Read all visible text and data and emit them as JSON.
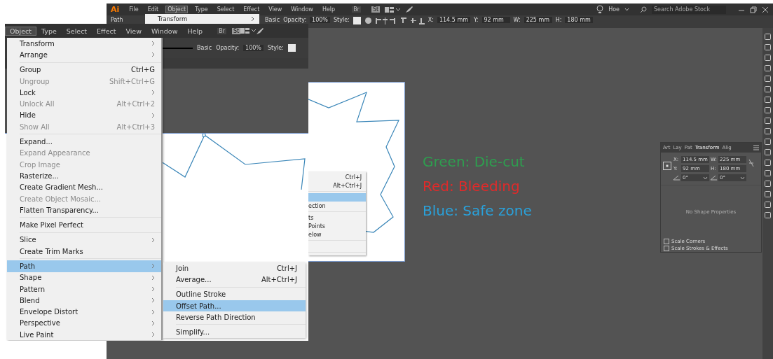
{
  "back_window": {
    "app_logo": "Ai",
    "menu": [
      {
        "label": "File",
        "selected": false
      },
      {
        "label": "Edit",
        "selected": false
      },
      {
        "label": "Object",
        "selected": true
      },
      {
        "label": "Type",
        "selected": false
      },
      {
        "label": "Select",
        "selected": false
      },
      {
        "label": "Effect",
        "selected": false
      },
      {
        "label": "View",
        "selected": false
      },
      {
        "label": "Window",
        "selected": false
      },
      {
        "label": "Help",
        "selected": false
      }
    ],
    "bridge_button": "Br",
    "stock_button": "St",
    "workspace": "Hoe",
    "search": {
      "placeholder": "Search Adobe Stock"
    },
    "open_menu": {
      "label": "Transform"
    },
    "control_bar": {
      "selection": "Path",
      "brush": "Basic",
      "opacity_label": "Opacity:",
      "opacity": "100%",
      "style_label": "Style:",
      "fields": [
        {
          "label": "X:",
          "value": "114.5 mm"
        },
        {
          "label": "Y:",
          "value": "92 mm"
        },
        {
          "label": "W:",
          "value": "225 mm"
        },
        {
          "label": "H:",
          "value": "180 mm"
        }
      ]
    },
    "submenu_fragment": [
      {
        "kind": "shortcut",
        "text": "Ctrl+J"
      },
      {
        "kind": "shortcut",
        "text": "Alt+Ctrl+J"
      },
      {
        "kind": "separator"
      },
      {
        "kind": "highlight"
      },
      {
        "kind": "text",
        "text": "ection"
      },
      {
        "kind": "separator"
      },
      {
        "kind": "text",
        "text": "ts"
      },
      {
        "kind": "text",
        "text": "Points"
      },
      {
        "kind": "text",
        "text": "elow"
      },
      {
        "kind": "separator"
      },
      {
        "kind": "blank"
      },
      {
        "kind": "separator"
      }
    ],
    "annotations": [
      {
        "text": "Green: Die-cut",
        "color": "#2e9e4f"
      },
      {
        "text": "Red: Bleeding",
        "color": "#e02a2a"
      },
      {
        "text": "Blue: Safe zone",
        "color": "#2aa1da"
      }
    ],
    "transform_panel": {
      "tabs": [
        {
          "label": "Art",
          "selected": false
        },
        {
          "label": "Lay",
          "selected": false
        },
        {
          "label": "Pat",
          "selected": false
        },
        {
          "label": "Transform",
          "selected": true
        },
        {
          "label": "Alig",
          "selected": false
        }
      ],
      "fields": [
        {
          "label": "X:",
          "value": "114.5 mm"
        },
        {
          "label": "W:",
          "value": "225 mm"
        },
        {
          "label": "Y:",
          "value": "92 mm"
        },
        {
          "label": "H:",
          "value": "180 mm"
        }
      ],
      "angles": [
        {
          "value": "0°"
        },
        {
          "value": "0°"
        }
      ],
      "message": "No Shape Properties",
      "options": [
        {
          "label": "Scale Corners",
          "checked": false
        },
        {
          "label": "Scale Strokes & Effects",
          "checked": false
        }
      ]
    }
  },
  "front_window": {
    "menu": [
      {
        "label": "Object",
        "selected": true
      },
      {
        "label": "Type",
        "selected": false
      },
      {
        "label": "Select",
        "selected": false
      },
      {
        "label": "Effect",
        "selected": false
      },
      {
        "label": "View",
        "selected": false
      },
      {
        "label": "Window",
        "selected": false
      },
      {
        "label": "Help",
        "selected": false
      }
    ],
    "bridge_button": "Br",
    "stock_button": "St",
    "control_bar": {
      "brush": "Basic",
      "opacity_label": "Opacity:",
      "opacity": "100%",
      "style_label": "Style:"
    },
    "object_menu": [
      {
        "kind": "item",
        "label": "Transform",
        "submenu": true,
        "disabled": false,
        "selected": false
      },
      {
        "kind": "item",
        "label": "Arrange",
        "submenu": true,
        "disabled": false,
        "selected": false
      },
      {
        "kind": "separator"
      },
      {
        "kind": "item",
        "label": "Group",
        "shortcut": "Ctrl+G",
        "submenu": false,
        "disabled": false,
        "selected": false
      },
      {
        "kind": "item",
        "label": "Ungroup",
        "shortcut": "Shift+Ctrl+G",
        "submenu": false,
        "disabled": true,
        "selected": false
      },
      {
        "kind": "item",
        "label": "Lock",
        "submenu": true,
        "disabled": false,
        "selected": false
      },
      {
        "kind": "item",
        "label": "Unlock All",
        "shortcut": "Alt+Ctrl+2",
        "submenu": false,
        "disabled": true,
        "selected": false
      },
      {
        "kind": "item",
        "label": "Hide",
        "submenu": true,
        "disabled": false,
        "selected": false
      },
      {
        "kind": "item",
        "label": "Show All",
        "shortcut": "Alt+Ctrl+3",
        "submenu": false,
        "disabled": true,
        "selected": false
      },
      {
        "kind": "separator"
      },
      {
        "kind": "item",
        "label": "Expand...",
        "submenu": false,
        "disabled": false,
        "selected": false
      },
      {
        "kind": "item",
        "label": "Expand Appearance",
        "submenu": false,
        "disabled": true,
        "selected": false
      },
      {
        "kind": "item",
        "label": "Crop Image",
        "submenu": false,
        "disabled": true,
        "selected": false
      },
      {
        "kind": "item",
        "label": "Rasterize...",
        "submenu": false,
        "disabled": false,
        "selected": false
      },
      {
        "kind": "item",
        "label": "Create Gradient Mesh...",
        "submenu": false,
        "disabled": false,
        "selected": false
      },
      {
        "kind": "item",
        "label": "Create Object Mosaic...",
        "submenu": false,
        "disabled": true,
        "selected": false
      },
      {
        "kind": "item",
        "label": "Flatten Transparency...",
        "submenu": false,
        "disabled": false,
        "selected": false
      },
      {
        "kind": "separator"
      },
      {
        "kind": "item",
        "label": "Make Pixel Perfect",
        "submenu": false,
        "disabled": false,
        "selected": false
      },
      {
        "kind": "separator"
      },
      {
        "kind": "item",
        "label": "Slice",
        "submenu": true,
        "disabled": false,
        "selected": false
      },
      {
        "kind": "item",
        "label": "Create Trim Marks",
        "submenu": false,
        "disabled": false,
        "selected": false
      },
      {
        "kind": "separator"
      },
      {
        "kind": "item",
        "label": "Path",
        "submenu": true,
        "disabled": false,
        "selected": true
      },
      {
        "kind": "item",
        "label": "Shape",
        "submenu": true,
        "disabled": false,
        "selected": false
      },
      {
        "kind": "item",
        "label": "Pattern",
        "submenu": true,
        "disabled": false,
        "selected": false
      },
      {
        "kind": "item",
        "label": "Blend",
        "submenu": true,
        "disabled": false,
        "selected": false
      },
      {
        "kind": "item",
        "label": "Envelope Distort",
        "submenu": true,
        "disabled": false,
        "selected": false
      },
      {
        "kind": "item",
        "label": "Perspective",
        "submenu": true,
        "disabled": false,
        "selected": false
      },
      {
        "kind": "item",
        "label": "Live Paint",
        "submenu": true,
        "disabled": false,
        "selected": false
      }
    ],
    "path_submenu": [
      {
        "kind": "item",
        "label": "Join",
        "shortcut": "Ctrl+J",
        "submenu": false,
        "disabled": false,
        "selected": false
      },
      {
        "kind": "item",
        "label": "Average...",
        "shortcut": "Alt+Ctrl+J",
        "submenu": false,
        "disabled": false,
        "selected": false
      },
      {
        "kind": "separator"
      },
      {
        "kind": "item",
        "label": "Outline Stroke",
        "submenu": false,
        "disabled": false,
        "selected": false
      },
      {
        "kind": "item",
        "label": "Offset Path...",
        "submenu": false,
        "disabled": false,
        "selected": true
      },
      {
        "kind": "item",
        "label": "Reverse Path Direction",
        "submenu": false,
        "disabled": false,
        "selected": false
      },
      {
        "kind": "separator"
      },
      {
        "kind": "item",
        "label": "Simplify...",
        "submenu": false,
        "disabled": false,
        "selected": false
      }
    ]
  }
}
